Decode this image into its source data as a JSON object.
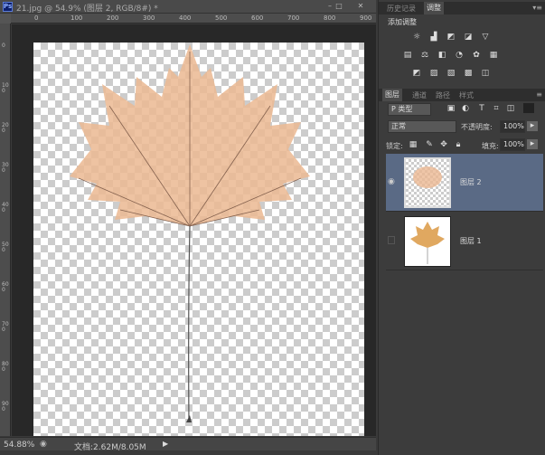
{
  "window": {
    "app_icon": "Ps",
    "title": "21.jpg @ 54.9% (图层 2, RGB/8#) *",
    "minimize": "–",
    "maximize": "□",
    "close": "✕"
  },
  "rulers": {
    "top": [
      "0",
      "100",
      "200",
      "300",
      "400",
      "500",
      "600",
      "700",
      "800",
      "900"
    ],
    "left": [
      "0",
      "100",
      "200",
      "300",
      "400",
      "500",
      "600",
      "700",
      "800",
      "900",
      "1000"
    ]
  },
  "status": {
    "zoom": "54.88%",
    "doc_info": "文档:2.62M/8.05M",
    "arrow": "▶"
  },
  "panel_top": {
    "tabs": [
      "历史记录",
      "调整"
    ],
    "active_tab": 1,
    "heading": "添加调整",
    "adjust_rows": [
      [
        "brightness-icon",
        "levels-icon",
        "curves-icon",
        "exposure-icon",
        "vibrance-icon"
      ],
      [
        "hue-saturation-icon",
        "color-balance-icon",
        "black-white-icon",
        "photo-filter-icon",
        "channel-mixer-icon",
        "color-lookup-icon"
      ],
      [
        "invert-icon",
        "posterize-icon",
        "threshold-icon",
        "gradient-map-icon",
        "selective-color-icon"
      ]
    ]
  },
  "layers_panel": {
    "tabs": [
      "图层",
      "通道",
      "路径",
      "样式"
    ],
    "active_tab": 0,
    "filter_kind": "P 类型",
    "blend_mode": "正常",
    "opacity_label": "不透明度:",
    "opacity": "100%",
    "lock_label": "锁定:",
    "fill_label": "填充:",
    "fill": "100%",
    "layers": [
      {
        "name": "图层 2",
        "visible": true,
        "selected": true
      },
      {
        "name": "图层 1",
        "visible": false,
        "selected": false
      }
    ]
  },
  "colors": {
    "selected_layer": "#5a6a85",
    "leaf": "#e8b48a",
    "canvas_bg": "#282828"
  }
}
